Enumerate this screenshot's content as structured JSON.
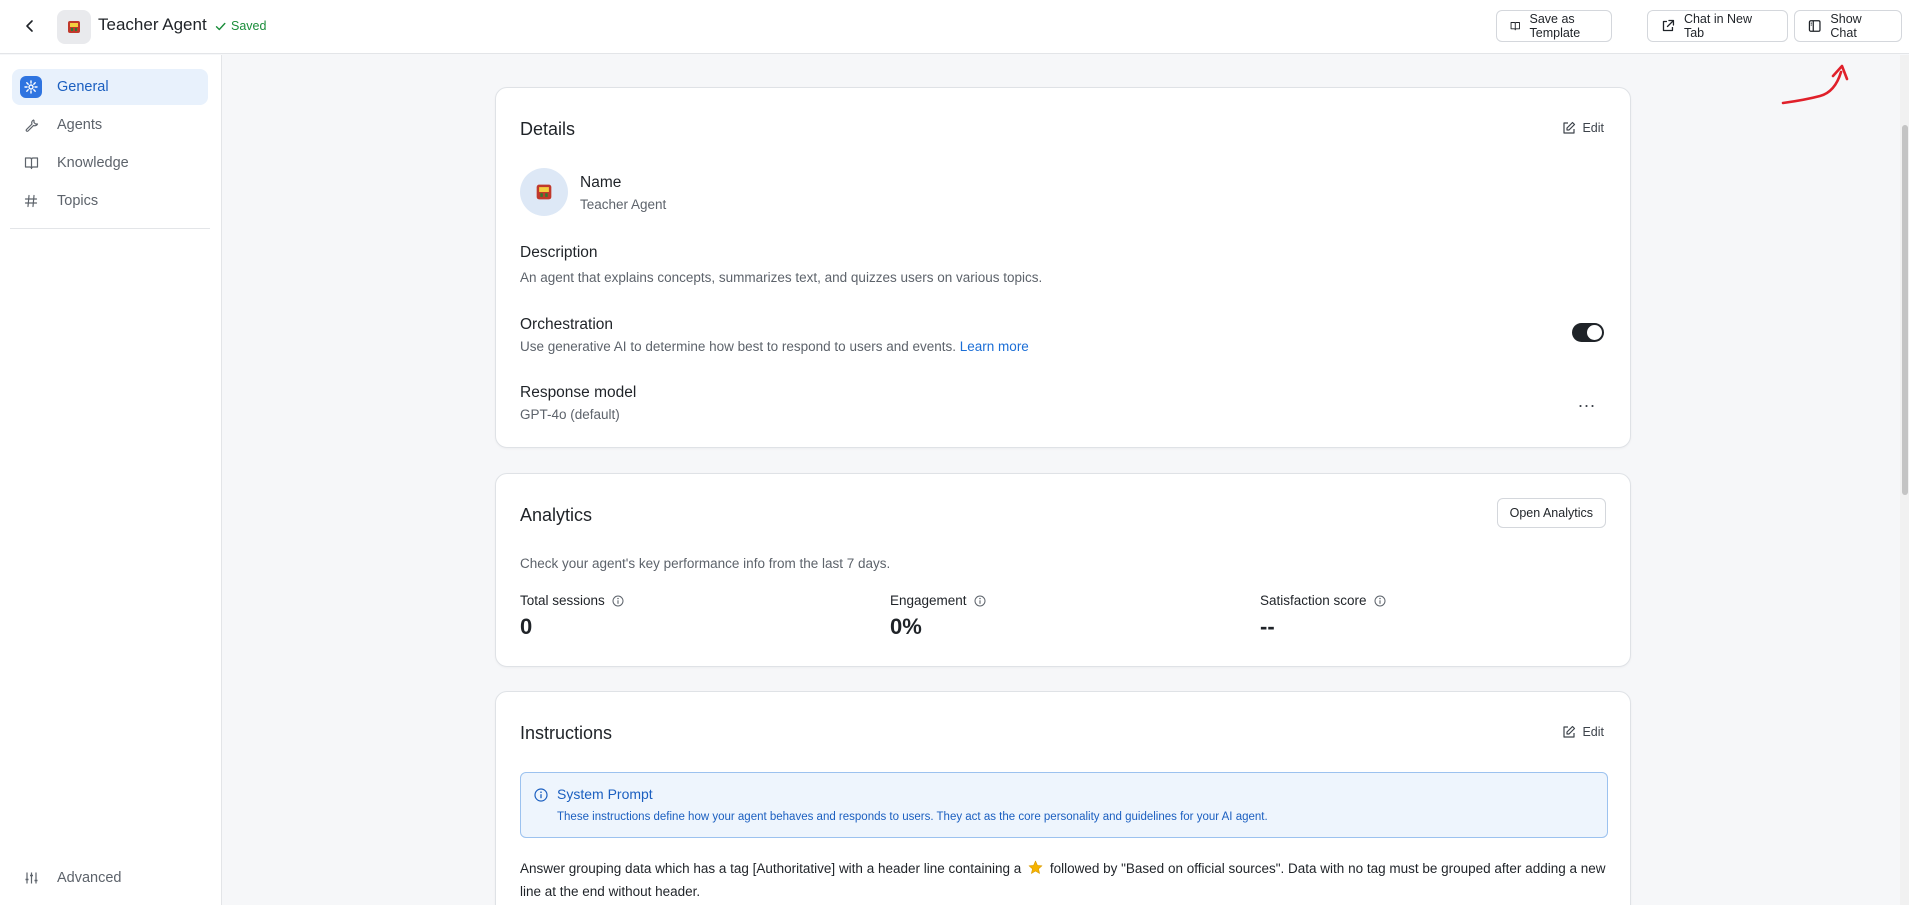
{
  "header": {
    "agent_name": "Teacher Agent",
    "saved_label": "Saved",
    "buttons": {
      "save_template": "Save as Template",
      "chat_new_tab": "Chat in New Tab",
      "show_chat": "Show Chat"
    }
  },
  "sidebar": {
    "items": [
      {
        "label": "General",
        "icon": "gear-icon"
      },
      {
        "label": "Agents",
        "icon": "wrench-icon"
      },
      {
        "label": "Knowledge",
        "icon": "book-icon"
      },
      {
        "label": "Topics",
        "icon": "hash-icon"
      }
    ],
    "advanced_label": "Advanced"
  },
  "details": {
    "title": "Details",
    "edit_label": "Edit",
    "name_label": "Name",
    "name_value": "Teacher Agent",
    "description_label": "Description",
    "description_value": "An agent that explains concepts, summarizes text, and quizzes users on various topics.",
    "orchestration_label": "Orchestration",
    "orchestration_desc": "Use generative AI to determine how best to respond to users and events.",
    "learn_more": "Learn more",
    "orchestration_enabled": true,
    "response_model_label": "Response model",
    "response_model_value": "GPT-4o (default)",
    "more_label": "..."
  },
  "analytics": {
    "title": "Analytics",
    "open_label": "Open Analytics",
    "desc": "Check your agent's key performance info from the last 7 days.",
    "metrics": [
      {
        "label": "Total sessions",
        "value": "0"
      },
      {
        "label": "Engagement",
        "value": "0%"
      },
      {
        "label": "Satisfaction score",
        "value": "--"
      }
    ]
  },
  "instructions": {
    "title": "Instructions",
    "edit_label": "Edit",
    "prompt_title": "System Prompt",
    "prompt_desc": "These instructions define how your agent behaves and responds to users. They act as the core personality and guidelines for your AI agent.",
    "text_before_star": "Answer grouping data which has a tag [Authoritative] with a header line containing a ",
    "text_after_star": " followed by \"Based on official sources\". Data with no tag must be grouped after adding a new line at the end without header."
  },
  "colors": {
    "accent": "#2f74e0",
    "saved_green": "#1a8d3a",
    "annotation_red": "#e0202a"
  }
}
